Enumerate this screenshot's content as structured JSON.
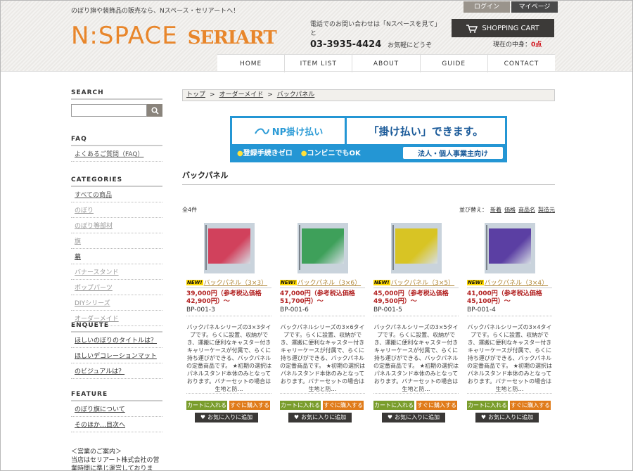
{
  "header": {
    "tagline": "のぼり旗や装飾品の販売なら、Nスペース・セリアートへ！",
    "logo_main": "N:SPACE",
    "logo_sub": "SERIART",
    "contact_line1": "電話でのお問い合わせは「Nスペースを見て」と",
    "phone": "03-3935-4424",
    "contact_line2": "お気軽にどうぞ",
    "login_label": "ログイン",
    "mypage_label": "マイページ",
    "cart_label": "SHOPPING CART",
    "cart_count_label": "現在の中身：",
    "cart_count_value": "0点"
  },
  "nav": {
    "items": [
      "HOME",
      "ITEM LIST",
      "ABOUT",
      "GUIDE",
      "CONTACT"
    ]
  },
  "sidebar": {
    "search_title": "SEARCH",
    "search_placeholder": "",
    "faq_title": "FAQ",
    "faq_items": [
      "よくあるご質問（FAQ）"
    ],
    "categories_title": "CATEGORIES",
    "categories": [
      "すべての商品",
      "のぼり",
      "のぼり等部材",
      "旗",
      "幕",
      "バナースタンド",
      "ポップパーツ",
      "DIYシリーズ",
      "オーダーメイド"
    ],
    "enquete_title": "ENQUETE",
    "enquete_items": [
      "ほしいのぼりのタイトルは？",
      "ほしいデコレーションマット",
      "のビジュアルは？"
    ],
    "feature_title": "FEATURE",
    "feature_items": [
      "のぼり旗について",
      "そのほか…目次へ"
    ],
    "notice_title": "＜営業のご案内＞",
    "notice_text": "当店はセリアート株式会社の営業時間に準じ運営しております。"
  },
  "main": {
    "breadcrumb": [
      "トップ",
      "オーダーメイド",
      "バックパネル"
    ],
    "banner_left": "NP掛け払い",
    "banner_right": "「掛け払い」できます。",
    "banner_b1": "登録手続きゼロ",
    "banner_b2": "コンビニでもOK",
    "banner_pill": "法人・個人事業主向け",
    "title": "バックパネル",
    "count": "全4件",
    "sort_label": "並び替え：",
    "sort_options": [
      "新着",
      "価格",
      "商品名",
      "製造元"
    ]
  },
  "products": [
    {
      "new_tag": "NEW!",
      "name": "バックパネル（3×3）",
      "price": "39,000円（参考税込価格42,900円）～",
      "code": "BP-001-3",
      "desc": "バックパネルシリーズの3×3タイプです。らくに設置、収納ができ、運搬に便利なキャスター付きキャリーケースが付属で、らくに持ち運びができる、バックパネルの定番商品です。 ★初期の選択はパネルスタンド本体のみとなっております。バナーセットの場合は生地と防…",
      "color": "#d1415c"
    },
    {
      "new_tag": "NEW!",
      "name": "バックパネル（3×6）",
      "price": "47,000円（参考税込価格51,700円）～",
      "code": "BP-001-6",
      "desc": "バックパネルシリーズの3×6タイプです。らくに設置、収納ができ、運搬に便利なキャスター付きキャリーケースが付属で、らくに持ち運びができる、バックパネルの定番商品です。 ★初期の選択はパネルスタンド本体のみとなっております。バナーセットの場合は生地と防…",
      "color": "#3ea05a"
    },
    {
      "new_tag": "NEW!",
      "name": "バックパネル（3×5）",
      "price": "45,000円（参考税込価格49,500円）～",
      "code": "BP-001-5",
      "desc": "バックパネルシリーズの3×5タイプです。らくに設置、収納ができ、運搬に便利なキャスター付きキャリーケースが付属で、らくに持ち運びができる、バックパネルの定番商品です。 ★初期の選択はパネルスタンド本体のみとなっております。バナーセットの場合は生地と防…",
      "color": "#d8c424"
    },
    {
      "new_tag": "NEW!",
      "name": "バックパネル（3×4）",
      "price": "41,000円（参考税込価格45,100円）～",
      "code": "BP-001-4",
      "desc": "バックパネルシリーズの3×4タイプです。らくに設置、収納ができ、運搬に便利なキャスター付きキャリーケースが付属で、らくに持ち運びができる、バックパネルの定番商品です。 ★初期の選択はパネルスタンド本体のみとなっております。バナーセットの場合は生地と防…",
      "color": "#5b3fa3"
    }
  ],
  "buttons": {
    "cart": "カートに入れる",
    "buy": "すぐに購入する",
    "fav": "お気に入りに追加"
  },
  "colors": {
    "accent": "#e8862b",
    "cart_green": "#7a9d2c",
    "buy_orange": "#e07b1a",
    "price_red": "#b22222"
  }
}
